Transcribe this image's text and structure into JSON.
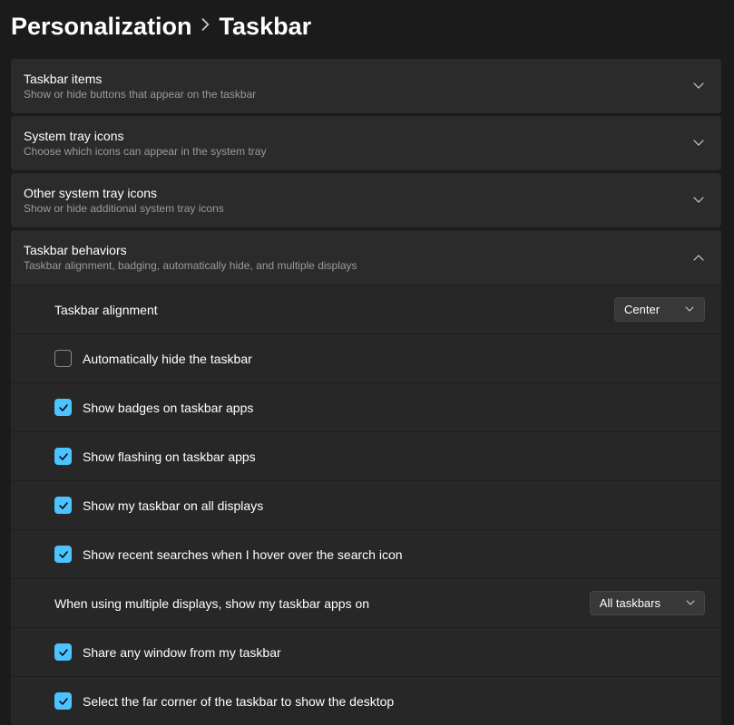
{
  "breadcrumb": {
    "parent": "Personalization",
    "current": "Taskbar"
  },
  "panels": {
    "taskbar_items": {
      "title": "Taskbar items",
      "subtitle": "Show or hide buttons that appear on the taskbar"
    },
    "system_tray": {
      "title": "System tray icons",
      "subtitle": "Choose which icons can appear in the system tray"
    },
    "other_system_tray": {
      "title": "Other system tray icons",
      "subtitle": "Show or hide additional system tray icons"
    },
    "behaviors": {
      "title": "Taskbar behaviors",
      "subtitle": "Taskbar alignment, badging, automatically hide, and multiple displays"
    }
  },
  "settings": {
    "alignment": {
      "label": "Taskbar alignment",
      "value": "Center"
    },
    "auto_hide": {
      "label": "Automatically hide the taskbar",
      "checked": false
    },
    "show_badges": {
      "label": "Show badges on taskbar apps",
      "checked": true
    },
    "show_flashing": {
      "label": "Show flashing on taskbar apps",
      "checked": true
    },
    "show_all_displays": {
      "label": "Show my taskbar on all displays",
      "checked": true
    },
    "recent_searches": {
      "label": "Show recent searches when I hover over the search icon",
      "checked": true
    },
    "multiple_displays": {
      "label": "When using multiple displays, show my taskbar apps on",
      "value": "All taskbars"
    },
    "share_window": {
      "label": "Share any window from my taskbar",
      "checked": true
    },
    "far_corner": {
      "label": "Select the far corner of the taskbar to show the desktop",
      "checked": true
    }
  }
}
